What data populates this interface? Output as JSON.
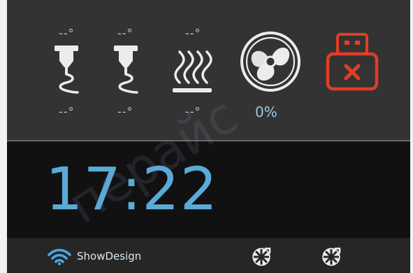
{
  "status": {
    "extruder1": {
      "target": "--°",
      "current": "--°"
    },
    "extruder2": {
      "target": "--°",
      "current": "--°"
    },
    "bed": {
      "target": "--°",
      "current": "--°"
    },
    "fan": {
      "speed": "0%"
    }
  },
  "clock": {
    "time": "17:22"
  },
  "network": {
    "name": "ShowDesign"
  },
  "colors": {
    "accent_blue": "#5aaad8",
    "text_blue": "#a6cde8",
    "usb_error": "#e23d25",
    "icon_white": "#ececec"
  },
  "icons": {
    "extruder": "nozzle-icon",
    "bed": "heated-bed-icon",
    "fan": "fan-icon",
    "usb": "usb-error-icon",
    "wifi": "wifi-icon",
    "filament": "filament-spool-icon"
  },
  "watermark": {
    "text": "перайс"
  }
}
